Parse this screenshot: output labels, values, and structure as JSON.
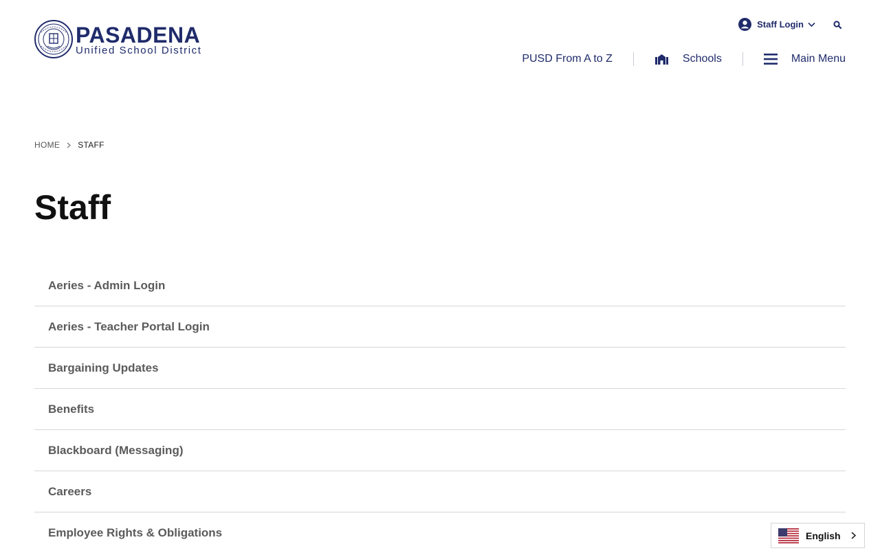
{
  "brand": {
    "title": "PASADENA",
    "subtitle": "Unified School District",
    "colors": {
      "primary": "#1f2b6b",
      "text": "#111111",
      "muted": "#5b5b5b"
    }
  },
  "topbar": {
    "staff_login_label": "Staff Login",
    "user_icon": "user-circle-icon",
    "search_icon": "search-icon"
  },
  "nav": {
    "a_to_z": "PUSD From A to Z",
    "schools": "Schools",
    "main_menu": "Main Menu"
  },
  "breadcrumb": {
    "home": "HOME",
    "current": "STAFF"
  },
  "page": {
    "title": "Staff"
  },
  "links": [
    "Aeries - Admin Login",
    "Aeries - Teacher Portal Login",
    "Bargaining Updates",
    "Benefits",
    "Blackboard (Messaging)",
    "Careers",
    "Employee Rights & Obligations"
  ],
  "language": {
    "label": "English",
    "flag_icon": "us-flag-icon"
  }
}
